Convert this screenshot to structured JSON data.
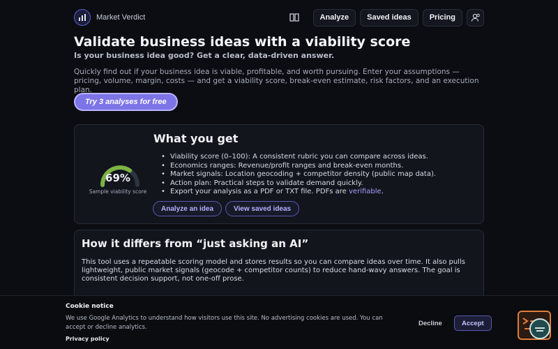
{
  "header": {
    "brand": "Market Verdict",
    "nav": [
      "Analyze",
      "Saved ideas",
      "Pricing"
    ]
  },
  "hero": {
    "title": "Validate business ideas with a viability score",
    "subtitle": "Is your business idea good? Get a clear, data-driven answer.",
    "description": "Quickly find out if your business idea is viable, profitable, and worth pursuing. Enter your assumptions — pricing, volume, margin, costs — and get a viability score, break-even estimate, risk factors, and an execution plan.",
    "cta": "Try 3 analyses for free"
  },
  "card1": {
    "gauge_value": "69%",
    "gauge_fraction": 0.69,
    "gauge_caption": "Sample viability score",
    "title": "What you get",
    "features": [
      "Viability score (0–100): A consistent rubric you can compare across ideas.",
      "Economics ranges: Revenue/profit ranges and break-even months.",
      "Market signals: Location geocoding + competitor density (public map data).",
      "Action plan: Practical steps to validate demand quickly."
    ],
    "export_text": "Export your analysis as a PDF or TXT file. PDFs are ",
    "export_link": "verifiable",
    "export_end": ".",
    "btn_analyze": "Analyze an idea",
    "btn_saved": "View saved ideas"
  },
  "card2": {
    "title": "How it differs from “just asking an AI”",
    "body": "This tool uses a repeatable scoring model and stores results so you can compare ideas over time. It also pulls lightweight, public market signals (geocode + competitor counts) to reduce hand-wavy answers. The goal is consistent decision support, not one-off prose."
  },
  "cookie": {
    "title": "Cookie notice",
    "text": "We use Google Analytics to understand how visitors use this site. No advertising cookies are used. You can accept or decline analytics.",
    "policy_link": "Privacy policy",
    "decline": "Decline",
    "accept": "Accept"
  },
  "colors": {
    "accent": "#7d74e8",
    "gauge_fill": "#7cb342",
    "gauge_track": "#2e3440",
    "widget_border": "#e07d3c"
  }
}
